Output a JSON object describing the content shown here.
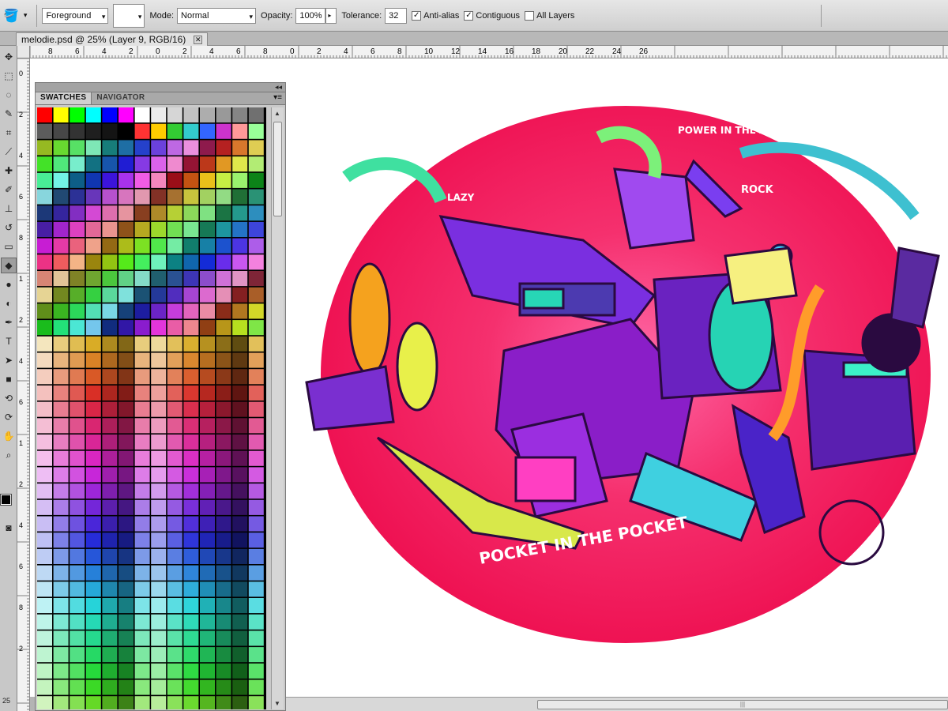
{
  "options_bar": {
    "tool_icon": "paint-bucket-icon",
    "fill_source": "Foreground",
    "mode_label": "Mode:",
    "mode_value": "Normal",
    "opacity_label": "Opacity:",
    "opacity_value": "100%",
    "tolerance_label": "Tolerance:",
    "tolerance_value": "32",
    "anti_alias_label": "Anti-alias",
    "anti_alias_checked": true,
    "contiguous_label": "Contiguous",
    "contiguous_checked": true,
    "all_layers_label": "All Layers",
    "all_layers_checked": false
  },
  "document_tab": {
    "title": "melodie.psd @ 25% (Layer 9, RGB/16)",
    "close_symbol": "✕"
  },
  "rulers": {
    "top_labels": [
      "8",
      "6",
      "4",
      "2",
      "0",
      "2",
      "4",
      "6",
      "8",
      "0",
      "2",
      "4",
      "6",
      "8",
      "10",
      "12",
      "14",
      "16",
      "18",
      "20",
      "22",
      "24",
      "26"
    ],
    "left_labels": [
      "0",
      "2",
      "4",
      "6",
      "8",
      "1",
      "2",
      "4",
      "6",
      "1",
      "2",
      "4",
      "6",
      "8",
      "2"
    ],
    "bottom_left_number": "25"
  },
  "swatches_panel": {
    "tabs": [
      "SWATCHES",
      "NAVIGATOR"
    ],
    "active_tab": "SWATCHES",
    "collapse_symbol": "◂◂",
    "menu_symbol": "▾≡"
  },
  "tools": [
    "move-icon",
    "marquee-icon",
    "lasso-icon",
    "quick-select-icon",
    "crop-icon",
    "eyedropper-icon",
    "healing-icon",
    "brush-icon",
    "stamp-icon",
    "history-brush-icon",
    "eraser-icon",
    "paint-bucket-icon",
    "blur-icon",
    "dodge-icon",
    "pen-icon",
    "type-icon",
    "path-select-icon",
    "shape-icon",
    "3d-rotate-icon",
    "3d-orbit-icon",
    "hand-icon",
    "zoom-icon"
  ],
  "colors": {
    "foreground": "#000000",
    "background": "#5a1fb0",
    "artwork_circle": "#f0155a",
    "ui_panel": "#c9c9c9"
  },
  "artwork_text": {
    "badge_main": "POCKET IN THE POCKET",
    "badge_top": "POWER IN THE AIR",
    "badge_rock": "ROCK",
    "badge_lazy": "LAZY"
  }
}
